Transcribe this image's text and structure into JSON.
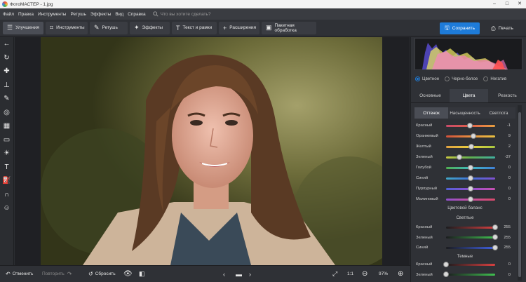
{
  "window": {
    "title": "ФотоМАСТЕР - 1.jpg"
  },
  "menu": {
    "items": [
      "Файл",
      "Правка",
      "Инструменты",
      "Ретушь",
      "Эффекты",
      "Вид",
      "Справка"
    ],
    "search_placeholder": "Что вы хотите сделать?"
  },
  "toolbar": {
    "tabs": [
      {
        "label": "Улучшения",
        "icon": "sliders-icon"
      },
      {
        "label": "Инструменты",
        "icon": "crop-icon"
      },
      {
        "label": "Ретушь",
        "icon": "brush-icon"
      },
      {
        "label": "Эффекты",
        "icon": "wand-icon"
      },
      {
        "label": "Текст и рамки",
        "icon": "text-icon"
      },
      {
        "label": "Расширения",
        "icon": "plus-icon"
      },
      {
        "label": "Пакетная обработка",
        "icon": "batch-icon"
      }
    ],
    "save_label": "Сохранить",
    "print_label": "Печать"
  },
  "bottom": {
    "undo_label": "Отменить",
    "redo_label": "Повторить",
    "reset_label": "Сбросить",
    "ratio_label": "1:1",
    "zoom_label": "97%"
  },
  "panel": {
    "modes": [
      "Цветное",
      "Черно-белое",
      "Негатив"
    ],
    "tabs": [
      "Основные",
      "Цвета",
      "Резкость"
    ],
    "subtabs": [
      "Оттенок",
      "Насыщенность",
      "Светлота"
    ],
    "hue_sliders": [
      {
        "label": "Красный",
        "value": "-1",
        "knob": 0.49
      },
      {
        "label": "Оранжевый",
        "value": "9",
        "knob": 0.55
      },
      {
        "label": "Желтый",
        "value": "2",
        "knob": 0.51
      },
      {
        "label": "Зеленый",
        "value": "-37",
        "knob": 0.27
      },
      {
        "label": "Голубой",
        "value": "0",
        "knob": 0.5
      },
      {
        "label": "Синий",
        "value": "0",
        "knob": 0.5
      },
      {
        "label": "Пурпурный",
        "value": "0",
        "knob": 0.5
      },
      {
        "label": "Малиновый",
        "value": "0",
        "knob": 0.5
      }
    ],
    "balance_title": "Цветовой баланс",
    "light_title": "Светлые",
    "light_sliders": [
      {
        "label": "Красный",
        "value": "255",
        "knob": 1.0
      },
      {
        "label": "Зеленый",
        "value": "255",
        "knob": 1.0
      },
      {
        "label": "Синий",
        "value": "255",
        "knob": 1.0
      }
    ],
    "dark_title": "Темные",
    "dark_sliders": [
      {
        "label": "Красный",
        "value": "0",
        "knob": 0.0
      },
      {
        "label": "Зеленый",
        "value": "0",
        "knob": 0.0
      }
    ]
  },
  "colors": {
    "accent": "#1e7bd8",
    "panel_bg": "#2f3136"
  }
}
